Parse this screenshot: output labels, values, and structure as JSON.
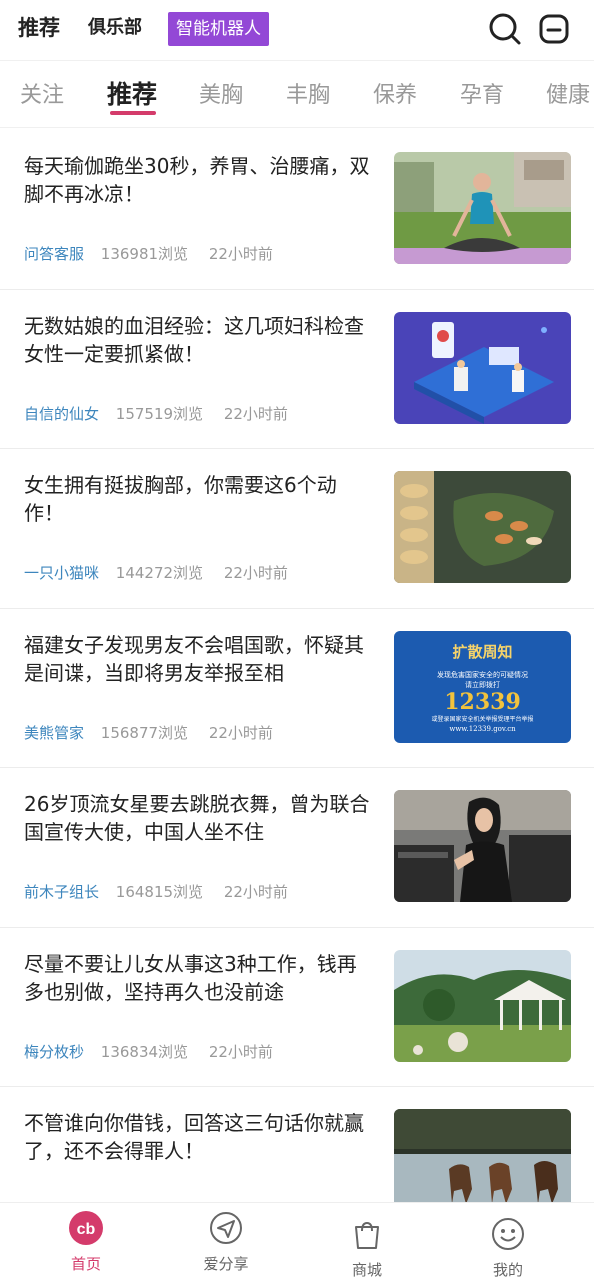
{
  "top_bar": {
    "active_tab": "推荐",
    "club_tab": "俱乐部",
    "robot_tab": "智能机器人",
    "search_icon": "search-icon",
    "message_icon": "message-icon"
  },
  "categories": {
    "active": "推荐",
    "items": [
      "关注",
      "推荐",
      "美胸",
      "丰胸",
      "保养",
      "孕育",
      "健康"
    ]
  },
  "feed": [
    {
      "title": "每天瑜伽跪坐30秒，养胃、治腰痛，双脚不再冰凉！",
      "author": "问答客服",
      "views": "136981浏览",
      "time": "22小时前",
      "thumb": "yoga-photo"
    },
    {
      "title": "无数姑娘的血泪经验：这几项妇科检查女性一定要抓紧做！",
      "author": "自信的仙女",
      "views": "157519浏览",
      "time": "22小时前",
      "thumb": "medical-illustration"
    },
    {
      "title": "女生拥有挺拔胸部，你需要这6个动作！",
      "author": "一只小猫咪",
      "views": "144272浏览",
      "time": "22小时前",
      "thumb": "food-photo"
    },
    {
      "title": "福建女子发现男友不会唱国歌，怀疑其是间谍，当即将男友举报至相",
      "author": "美熊管家",
      "views": "156877浏览",
      "time": "22小时前",
      "thumb": "notice-poster",
      "poster": {
        "heading": "扩散周知",
        "line1": "发现危害国家安全的可疑情况",
        "line2": "请立即拨打",
        "number": "12339",
        "line3": "或登录国家安全机关举报受理平台举报",
        "url": "www.12339.gov.cn"
      }
    },
    {
      "title": "26岁顶流女星要去跳脱衣舞，曾为联合国宣传大使，中国人坐不住",
      "author": "前木子组长",
      "views": "164815浏览",
      "time": "22小时前",
      "thumb": "woman-photo"
    },
    {
      "title": "尽量不要让儿女从事这3种工作，钱再多也别做，坚持再久也没前途",
      "author": "梅分枚秒",
      "views": "136834浏览",
      "time": "22小时前",
      "thumb": "pavilion-photo"
    },
    {
      "title": "不管谁向你借钱，回答这三句话你就赢了，还不会得罪人！",
      "author": "",
      "views": "",
      "time": "",
      "thumb": "horses-photo"
    }
  ],
  "bottom_nav": [
    {
      "label": "首页",
      "icon": "home-logo-icon",
      "active": true
    },
    {
      "label": "爱分享",
      "icon": "share-paper-plane-icon",
      "active": false
    },
    {
      "label": "商城",
      "icon": "shopping-bag-icon",
      "active": false
    },
    {
      "label": "我的",
      "icon": "smiley-face-icon",
      "active": false
    }
  ],
  "colors": {
    "accent": "#d43b6b",
    "robot_badge": "#9348d6",
    "author_link": "#3d86bd",
    "muted_text": "#999999"
  }
}
